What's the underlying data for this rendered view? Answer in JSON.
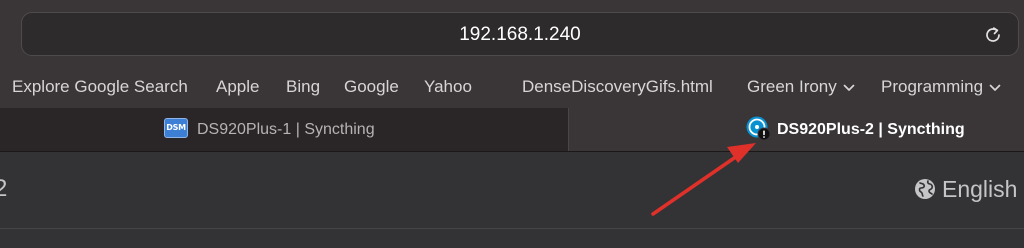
{
  "address_bar": {
    "url": "192.168.1.240",
    "reload_icon": "reload-icon"
  },
  "favorites": [
    {
      "label": "Explore Google Search",
      "has_menu": false
    },
    {
      "label": "Apple",
      "has_menu": false
    },
    {
      "label": "Bing",
      "has_menu": false
    },
    {
      "label": "Google",
      "has_menu": false
    },
    {
      "label": "Yahoo",
      "has_menu": false
    },
    {
      "label": "DenseDiscoveryGifs.html",
      "has_menu": false
    },
    {
      "label": "Green Irony",
      "has_menu": true
    },
    {
      "label": "Programming",
      "has_menu": true
    }
  ],
  "tabs": [
    {
      "title": "DS920Plus-1 | Syncthing",
      "icon": "dsm-icon",
      "icon_text": "DSM",
      "active": false
    },
    {
      "title": "DS920Plus-2 | Syncthing",
      "icon": "syncthing-icon",
      "active": true
    }
  ],
  "page": {
    "left_fragment": "2",
    "language_label": "English",
    "language_icon": "globe-icon"
  },
  "annotation": {
    "arrow_color": "#e0302a"
  },
  "colors": {
    "toolbar_bg": "#3a3637",
    "inactive_tab_bg": "#2a2627",
    "active_tab_bg": "#3a3637",
    "page_bg": "#333335",
    "dsm_blue": "#3d7fd4",
    "syncthing_blue": "#0891d1"
  }
}
